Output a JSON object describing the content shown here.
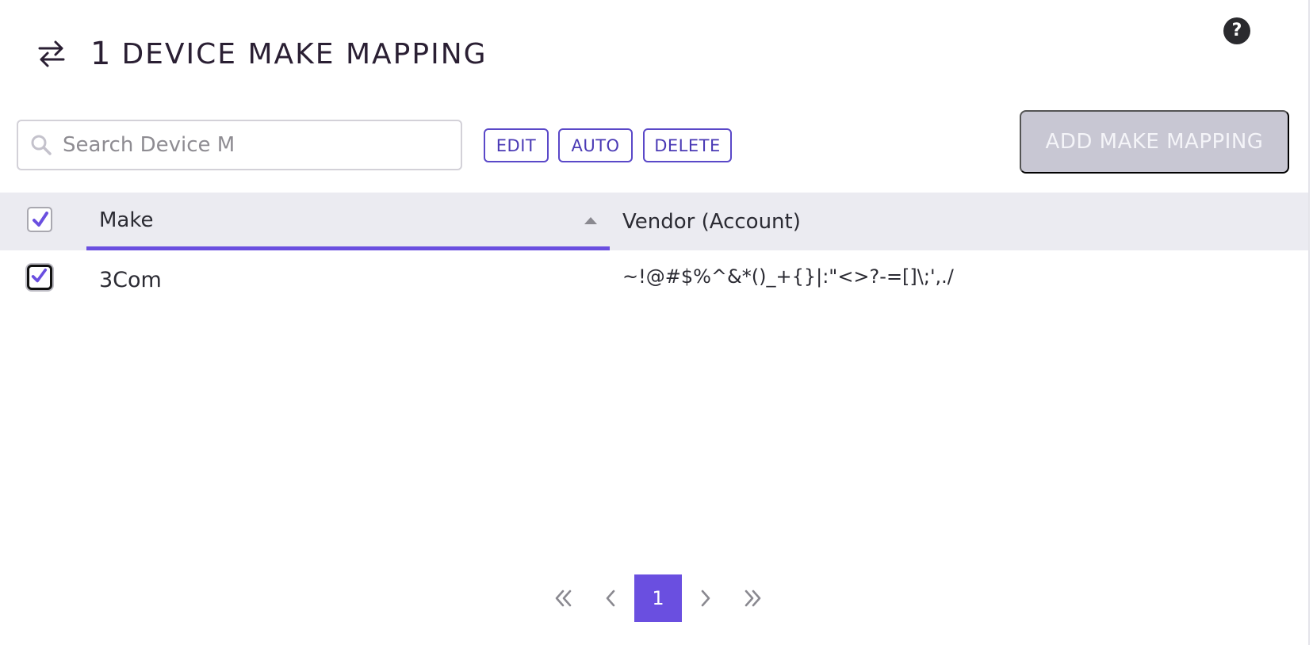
{
  "header": {
    "count": "1",
    "title": "DEVICE MAKE MAPPING",
    "icon": "swap-arrows-icon"
  },
  "help": {
    "label": "?"
  },
  "search": {
    "placeholder": "Search Device M",
    "value": ""
  },
  "toolbar": {
    "edit_label": "EDIT",
    "auto_label": "AUTO",
    "delete_label": "DELETE",
    "add_label": "ADD MAKE MAPPING"
  },
  "table": {
    "columns": {
      "make": "Make",
      "vendor": "Vendor (Account)"
    },
    "sort": {
      "column": "make",
      "direction": "ascending"
    },
    "select_all_checked": true,
    "rows": [
      {
        "make": "3Com",
        "vendor": "~!@#$%^&*()_+{}|:\"<>?-=[]\\;',./",
        "checked": true
      }
    ]
  },
  "pagination": {
    "current_page": "1"
  },
  "colors": {
    "accent": "#6a4fe0",
    "button_border": "#5a48c8",
    "disabled_button": "#c8c7d3",
    "header_bg": "#ebebf1"
  }
}
